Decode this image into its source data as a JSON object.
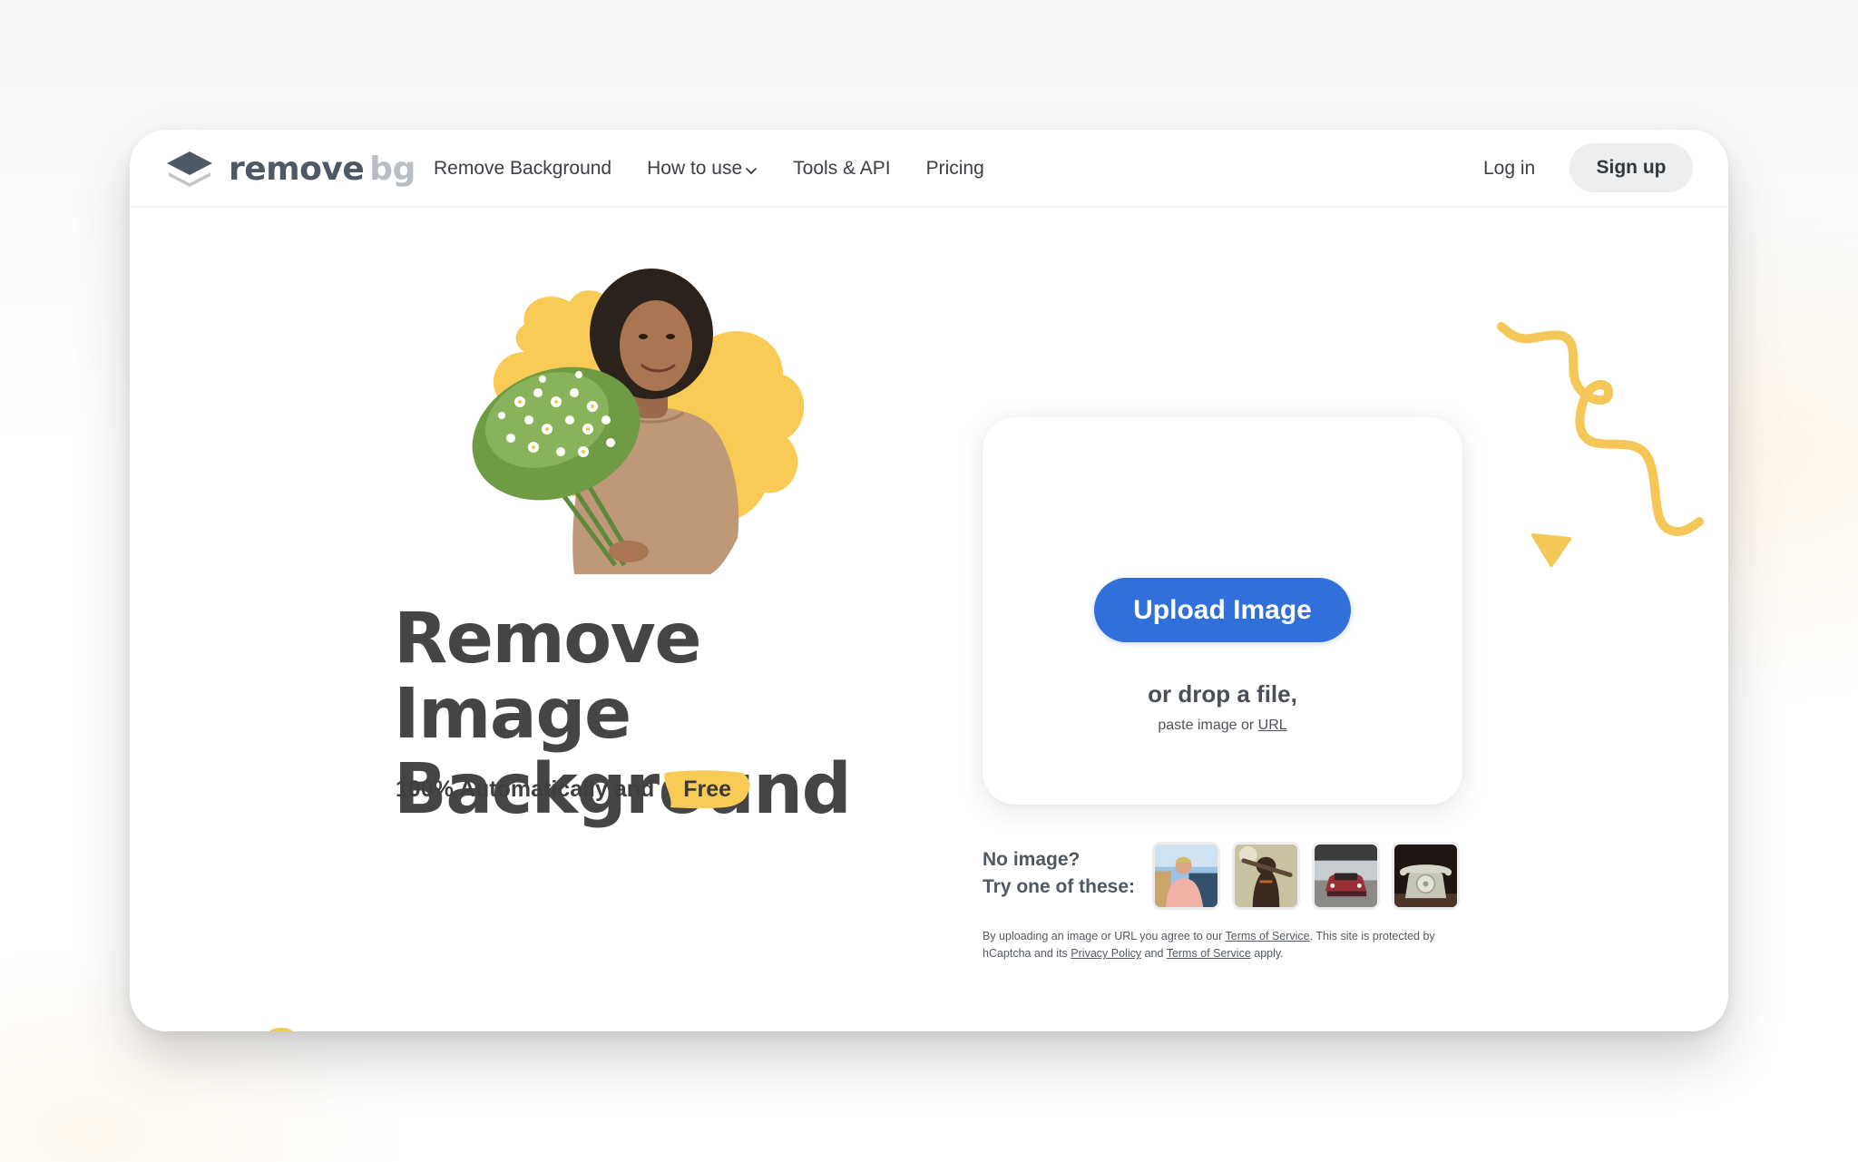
{
  "colors": {
    "accent_blue": "#316fdb",
    "accent_yellow": "#f8ca56",
    "text_dark": "#454545",
    "logo_dark": "#4f5965",
    "logo_light": "#b8bec4",
    "signup_bg": "#eceef0"
  },
  "header": {
    "logo": {
      "icon": "layers-icon",
      "text_main": "remove",
      "text_accent": "bg"
    },
    "nav": [
      {
        "label": "Remove Background"
      },
      {
        "label": "How to use",
        "icon": "chevron-down-icon"
      },
      {
        "label": "Tools & API"
      },
      {
        "label": "Pricing"
      }
    ],
    "login_label": "Log in",
    "signup_label": "Sign up"
  },
  "hero": {
    "image_alt": "Woman holding a bouquet of white flowers in front of a yellow blob",
    "title_line1": "Remove Image",
    "title_line2": "Background",
    "subtitle_prefix": "100% Automatically and",
    "subtitle_highlight": "Free"
  },
  "upload": {
    "button_label": "Upload Image",
    "drop_text": "or drop a file,",
    "paste_prefix": "paste image or",
    "paste_link": "URL"
  },
  "samples": {
    "label_line1": "No image?",
    "label_line2": "Try one of these:",
    "items": [
      {
        "name": "sample-person",
        "alt": "Man in pink t-shirt"
      },
      {
        "name": "sample-dog",
        "alt": "Dog with a stick"
      },
      {
        "name": "sample-car",
        "alt": "Red car"
      },
      {
        "name": "sample-phone",
        "alt": "Vintage rotary telephone"
      }
    ]
  },
  "legal": {
    "part1": "By uploading an image or URL you agree to our",
    "tos_link_1": "Terms of Service",
    "part2": ". This site is protected by hCaptcha and its",
    "privacy_link": "Privacy Policy",
    "part3": "and",
    "tos_link_2": "Terms of Service",
    "part4": "apply."
  }
}
